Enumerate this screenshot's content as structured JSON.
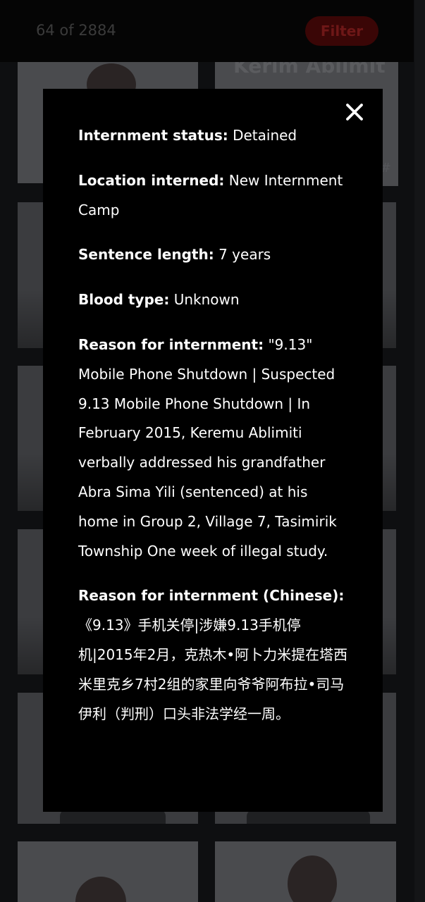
{
  "header": {
    "counter": "64 of 2884",
    "filter_label": "Filter"
  },
  "background": {
    "card_name": "Kerim Ablimit",
    "card_tag": "#"
  },
  "modal": {
    "close_icon": "close-x-icon",
    "fields": [
      {
        "label": "Internment status:",
        "value": "Detained"
      },
      {
        "label": "Location interned:",
        "value": "New Internment Camp"
      },
      {
        "label": "Sentence length:",
        "value": "7 years"
      },
      {
        "label": "Blood type:",
        "value": "Unknown"
      },
      {
        "label": "Reason for internment:",
        "value": "\"9.13\" Mobile Phone Shutdown | Suspected 9.13 Mobile Phone Shutdown | In February 2015, Keremu Ablimiti verbally addressed his grandfather Abra Sima Yili (sentenced) at his home in Group 2, Village 7, Tasimirik Township One week of illegal study."
      },
      {
        "label": "Reason for internment (Chinese):",
        "value": "《9.13》手机关停|涉嫌9.13手机停机|2015年2月，克热木•阿卜力米提在塔西米里克乡7村2组的家里向爷爷阿布拉•司马伊利（判刑）口头非法学经一周。"
      }
    ]
  },
  "colors": {
    "modal_bg": "#000000",
    "modal_text": "#ffffff",
    "filter_bg": "#3a0606",
    "filter_text": "#6e1717"
  }
}
